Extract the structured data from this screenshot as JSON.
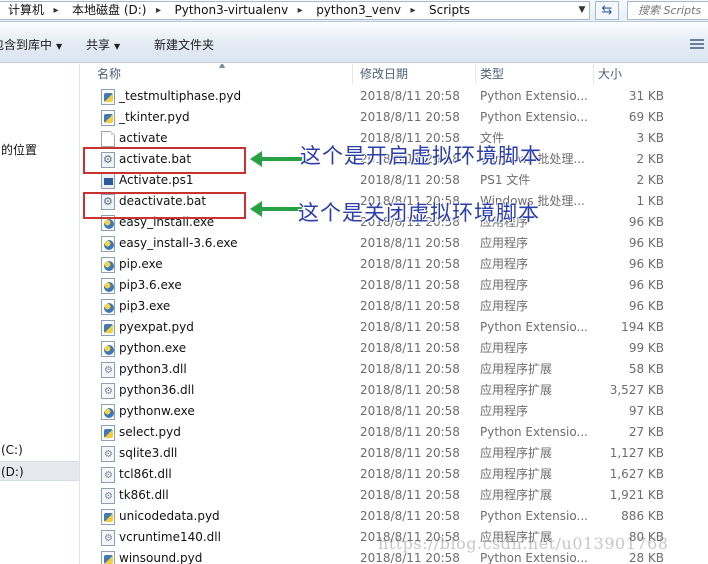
{
  "breadcrumb": [
    "计算机",
    "本地磁盘 (D:)",
    "Python3-virtualenv",
    "python3_venv",
    "Scripts"
  ],
  "search": {
    "placeholder": "搜索 Scripts"
  },
  "toolbar": {
    "include_library": "包含到库中",
    "share": "共享",
    "new_folder": "新建文件夹"
  },
  "nav": {
    "location": "的位置",
    "drive_c": "(C:)",
    "drive_d": "(D:)"
  },
  "columns": {
    "name": "名称",
    "date": "修改日期",
    "type": "类型",
    "size": "大小"
  },
  "files": [
    {
      "name": "_testmultiphase.pyd",
      "date": "2018/8/11 20:58",
      "type": "Python Extensio...",
      "size": "31 KB",
      "icon": "python-extension-icon"
    },
    {
      "name": "_tkinter.pyd",
      "date": "2018/8/11 20:58",
      "type": "Python Extensio...",
      "size": "69 KB",
      "icon": "python-extension-icon"
    },
    {
      "name": "activate",
      "date": "2018/8/11 20:58",
      "type": "文件",
      "size": "3 KB",
      "icon": "blank-file-icon"
    },
    {
      "name": "activate.bat",
      "date": "2018/8/11 20:58",
      "type": "Windows 批处理...",
      "size": "2 KB",
      "icon": "batch-file-icon"
    },
    {
      "name": "Activate.ps1",
      "date": "2018/8/11 20:58",
      "type": "PS1 文件",
      "size": "2 KB",
      "icon": "powershell-file-icon"
    },
    {
      "name": "deactivate.bat",
      "date": "2018/8/11 20:58",
      "type": "Windows 批处理...",
      "size": "1 KB",
      "icon": "batch-file-icon"
    },
    {
      "name": "easy_install.exe",
      "date": "2018/8/11 20:58",
      "type": "应用程序",
      "size": "96 KB",
      "icon": "python-exe-icon"
    },
    {
      "name": "easy_install-3.6.exe",
      "date": "2018/8/11 20:58",
      "type": "应用程序",
      "size": "96 KB",
      "icon": "python-exe-icon"
    },
    {
      "name": "pip.exe",
      "date": "2018/8/11 20:58",
      "type": "应用程序",
      "size": "96 KB",
      "icon": "python-exe-icon"
    },
    {
      "name": "pip3.6.exe",
      "date": "2018/8/11 20:58",
      "type": "应用程序",
      "size": "96 KB",
      "icon": "python-exe-icon"
    },
    {
      "name": "pip3.exe",
      "date": "2018/8/11 20:58",
      "type": "应用程序",
      "size": "96 KB",
      "icon": "python-exe-icon"
    },
    {
      "name": "pyexpat.pyd",
      "date": "2018/8/11 20:58",
      "type": "Python Extensio...",
      "size": "194 KB",
      "icon": "python-extension-icon"
    },
    {
      "name": "python.exe",
      "date": "2018/8/11 20:58",
      "type": "应用程序",
      "size": "99 KB",
      "icon": "python-exe-icon"
    },
    {
      "name": "python3.dll",
      "date": "2018/8/11 20:58",
      "type": "应用程序扩展",
      "size": "58 KB",
      "icon": "dll-file-icon"
    },
    {
      "name": "python36.dll",
      "date": "2018/8/11 20:58",
      "type": "应用程序扩展",
      "size": "3,527 KB",
      "icon": "dll-file-icon"
    },
    {
      "name": "pythonw.exe",
      "date": "2018/8/11 20:58",
      "type": "应用程序",
      "size": "97 KB",
      "icon": "python-exe-icon"
    },
    {
      "name": "select.pyd",
      "date": "2018/8/11 20:58",
      "type": "Python Extensio...",
      "size": "27 KB",
      "icon": "python-extension-icon"
    },
    {
      "name": "sqlite3.dll",
      "date": "2018/8/11 20:58",
      "type": "应用程序扩展",
      "size": "1,127 KB",
      "icon": "dll-file-icon"
    },
    {
      "name": "tcl86t.dll",
      "date": "2018/8/11 20:58",
      "type": "应用程序扩展",
      "size": "1,627 KB",
      "icon": "dll-file-icon"
    },
    {
      "name": "tk86t.dll",
      "date": "2018/8/11 20:58",
      "type": "应用程序扩展",
      "size": "1,921 KB",
      "icon": "dll-file-icon"
    },
    {
      "name": "unicodedata.pyd",
      "date": "2018/8/11 20:58",
      "type": "Python Extensio...",
      "size": "886 KB",
      "icon": "python-extension-icon"
    },
    {
      "name": "vcruntime140.dll",
      "date": "2018/8/11 20:58",
      "type": "应用程序扩展",
      "size": "80 KB",
      "icon": "dll-file-icon"
    },
    {
      "name": "winsound.pyd",
      "date": "2018/8/11 20:58",
      "type": "Python Extensio...",
      "size": "28 KB",
      "icon": "python-extension-icon"
    }
  ],
  "annotations": {
    "activate_note": "这个是开启虚拟环境脚本",
    "deactivate_note": "这个是关闭虚拟环境脚本",
    "box_color": "#c8332f",
    "arrow_color": "#27a143",
    "text_color": "#2b3fa8"
  },
  "watermark": "https://blog.csdn.net/u013901768"
}
